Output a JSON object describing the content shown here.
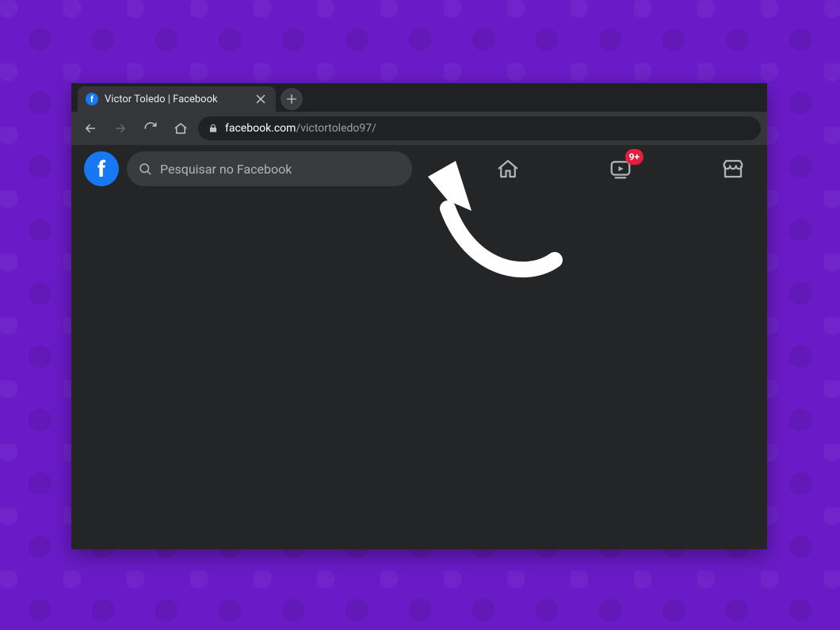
{
  "browser": {
    "tab": {
      "title": "Victor Toledo | Facebook",
      "favicon_letter": "f"
    },
    "omnibox": {
      "domain": "facebook.com",
      "path": "/victortoledo97/"
    }
  },
  "facebook": {
    "logo_letter": "f",
    "search": {
      "placeholder": "Pesquisar no Facebook"
    },
    "nav": {
      "watch_badge": "9+"
    }
  }
}
